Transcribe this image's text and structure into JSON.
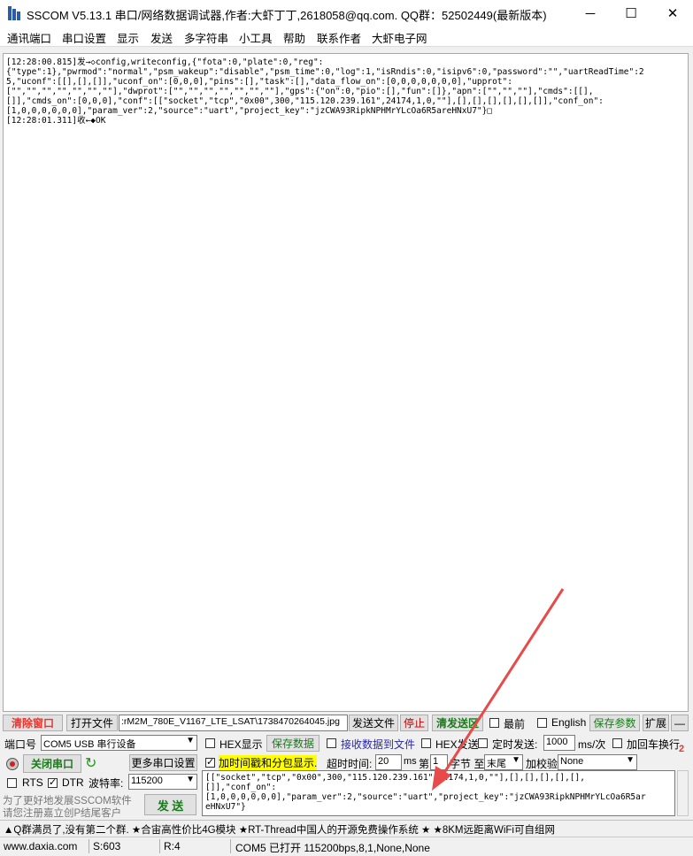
{
  "window": {
    "title": "SSCOM V5.13.1 串口/网络数据调试器,作者:大虾丁丁,2618058@qq.com. QQ群：52502449(最新版本)"
  },
  "menu": [
    "通讯端口",
    "串口设置",
    "显示",
    "发送",
    "多字符串",
    "小工具",
    "帮助",
    "联系作者",
    "大虾电子网"
  ],
  "log": {
    "text": "[12:28:00.815]发→◇config,writeconfig,{\"fota\":0,\"plate\":0,\"reg\":\n{\"type\":1},\"pwrmod\":\"normal\",\"psm_wakeup\":\"disable\",\"psm_time\":0,\"log\":1,\"isRndis\":0,\"isipv6\":0,\"password\":\"\",\"uartReadTime\":2\n5,\"uconf\":[[],[],[]],\"uconf_on\":[0,0,0],\"pins\":[],\"task\":[],\"data_flow_on\":[0,0,0,0,0,0,0],\"upprot\":\n[\"\",\"\",\"\",\"\",\"\",\"\",\"\"],\"dwprot\":[\"\",\"\",\"\",\"\",\"\",\"\",\"\"],\"gps\":{\"on\":0,\"pio\":[],\"fun\":[]},\"apn\":[\"\",\"\",\"\"],\"cmds\":[[],\n[]],\"cmds_on\":[0,0,0],\"conf\":[[\"socket\",\"tcp\",\"0x00\",300,\"115.120.239.161\",24174,1,0,\"\"],[],[],[],[],[],[]],\"conf_on\":\n[1,0,0,0,0,0,0],\"param_ver\":2,\"source\":\"uart\",\"project_key\":\"jzCWA93RipkNPHMrYLcOa6R5areHNxU7\"}□\n[12:28:01.311]收←◆OK"
  },
  "toolbar1": {
    "clear_window": "清除窗口",
    "open_file": "打开文件",
    "file_path": ":rM2M_780E_V1167_LTE_LSAT\\1738470264045.jpg",
    "send_file": "发送文件",
    "stop": "停止",
    "clear_send": "清发送区",
    "latest": "最前",
    "english": "English",
    "save_params": "保存参数",
    "expand": "扩展",
    "minus": "—"
  },
  "toolbar2": {
    "port_label": "端口号",
    "port_value": "COM5 USB 串行设备",
    "hex_display": "HEX显示",
    "save_data": "保存数据",
    "recv_to_file": "接收数据到文件",
    "hex_send": "HEX发送",
    "timed_send": "定时发送:",
    "interval_value": "1000",
    "interval_unit": "ms/次",
    "add_crlf": "加回车换行"
  },
  "toolbar3": {
    "close_port": "关闭串口",
    "more_settings": "更多串口设置",
    "timestamp": "加时间戳和分包显示.",
    "timeout_label": "超时时间:",
    "timeout_value": "20",
    "timeout_unit": "ms",
    "nth_label": "第",
    "nth_value": "1",
    "byte_label": "字节 至",
    "end_value": "末尾",
    "checksum_label": "加校验",
    "checksum_value": "None",
    "badge": "2"
  },
  "toolbar4": {
    "rts": "RTS",
    "dtr": "DTR",
    "baud_label": "波特率:",
    "baud_value": "115200"
  },
  "promo": {
    "line1": "为了更好地发展SSCOM软件",
    "line2": "请您注册嘉立创P结尾客户",
    "send_button": "发 送"
  },
  "send_area": {
    "text": "[[\"socket\",\"tcp\",\"0x00\",300,\"115.120.239.161\",24174,1,0,\"\"],[],[],[],[],[],\n[]],\"conf_on\":\n[1,0,0,0,0,0,0],\"param_ver\":2,\"source\":\"uart\",\"project_key\":\"jzCWA93RipkNPHMrYLcOa6R5ar\neHNxU7\"}"
  },
  "ticker": {
    "text": "▲Q群满员了,没有第二个群. ★合宙高性价比4G模块 ★RT-Thread中国人的开源免费操作系统 ★ ★8KM远距离WiFi可自组网"
  },
  "status": {
    "site": "www.daxia.com",
    "sent": "S:603",
    "recv": "R:4",
    "port_state": "COM5 已打开  115200bps,8,1,None,None"
  },
  "colors": {
    "accent_red": "#e8352e",
    "accent_green": "#1a7a1a",
    "highlight_yellow": "#ffff00",
    "arrow": "#e84a4a"
  }
}
